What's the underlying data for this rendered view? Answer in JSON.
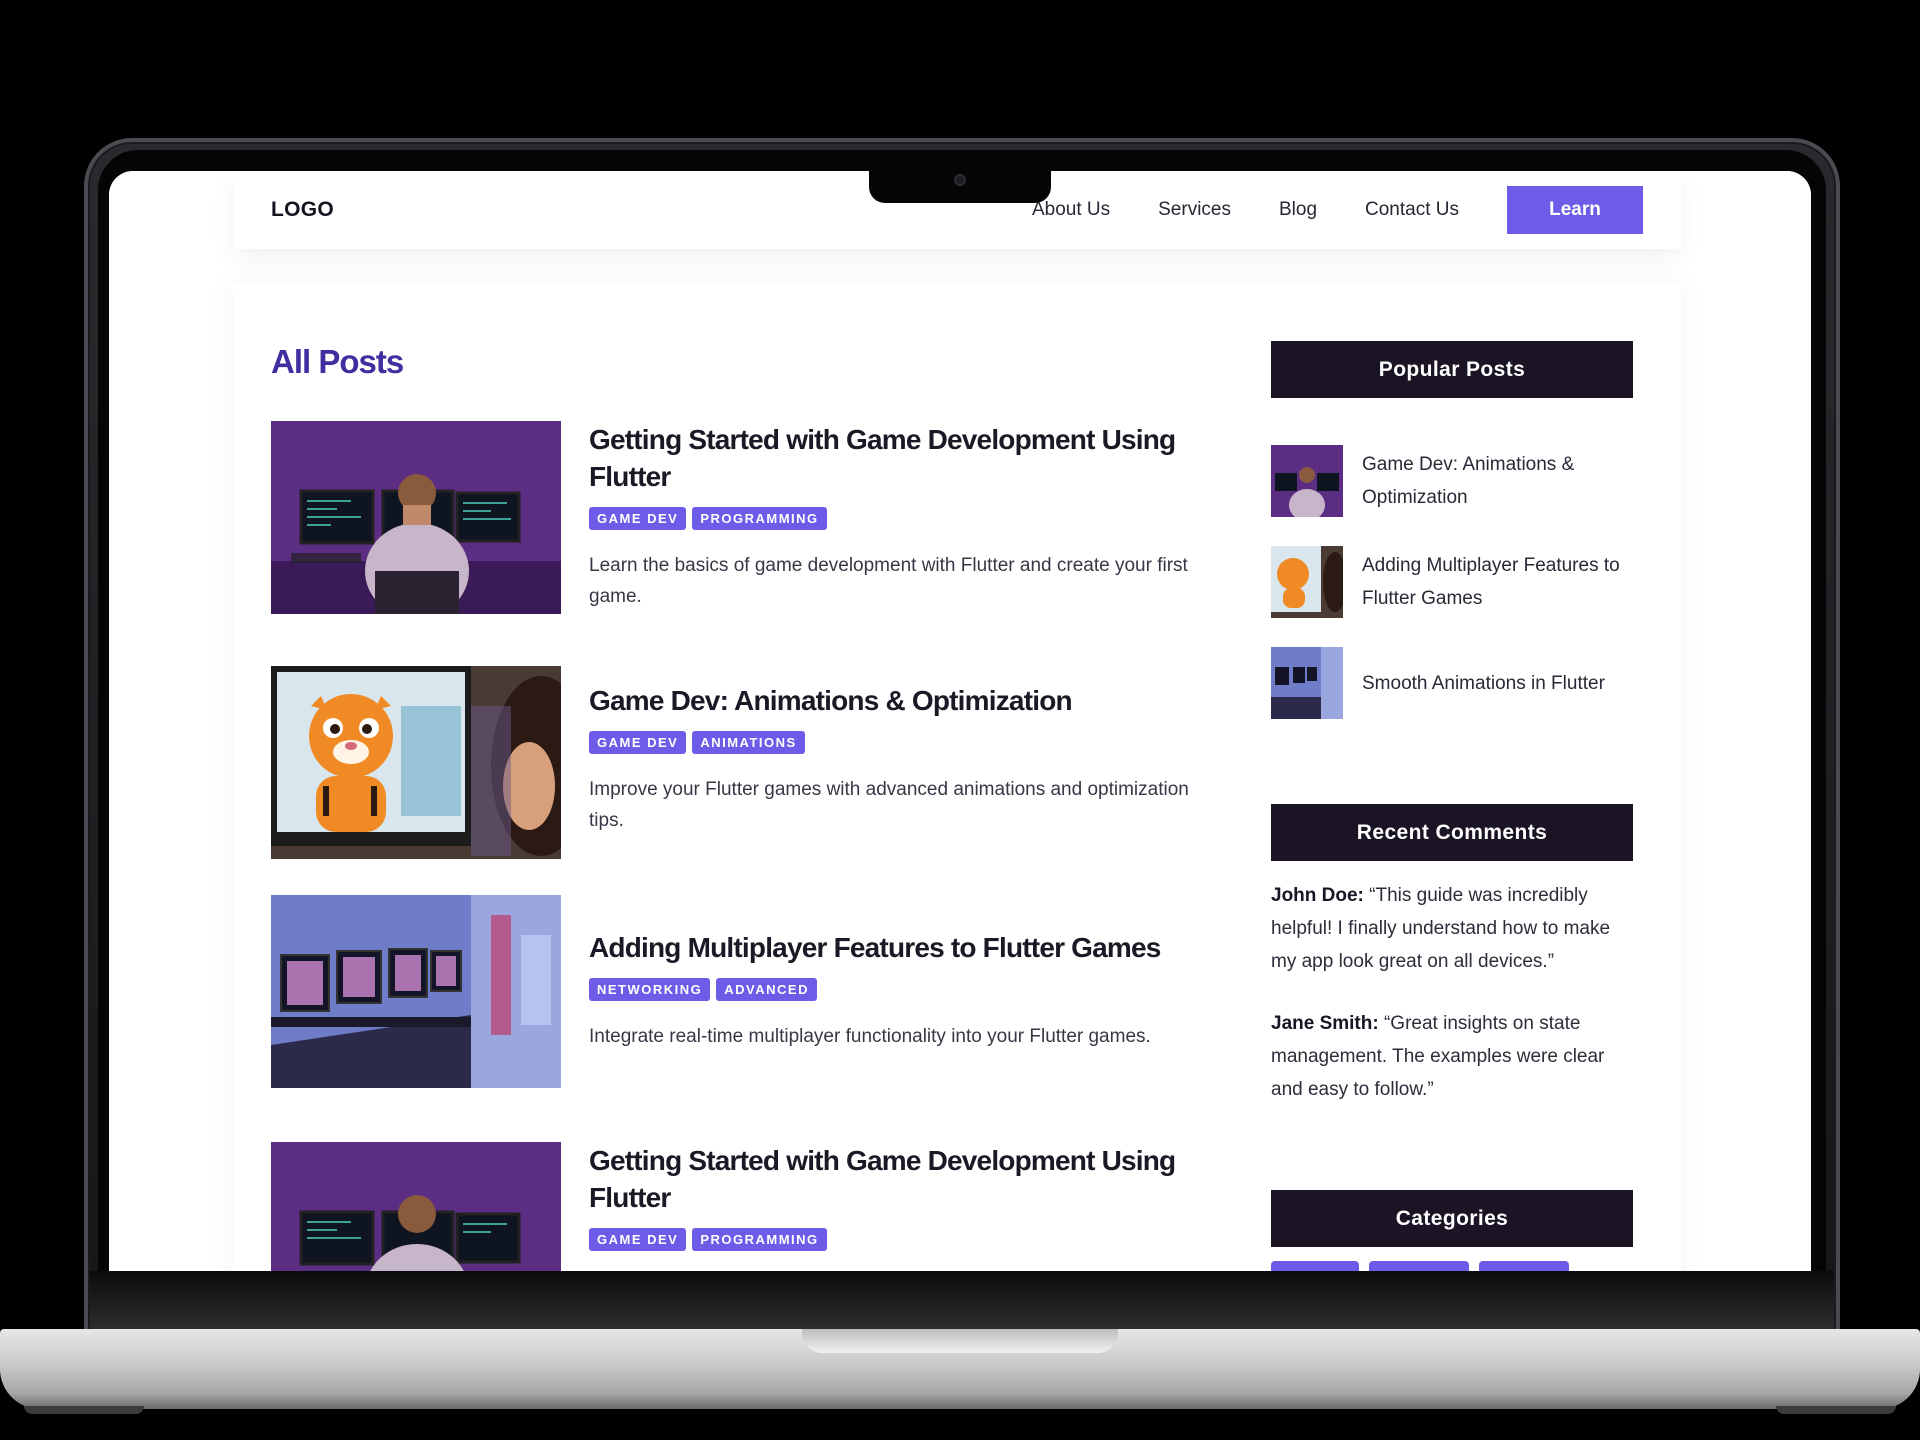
{
  "nav": {
    "logo": "LOGO",
    "links": [
      "About Us",
      "Services",
      "Blog",
      "Contact Us"
    ],
    "cta": "Learn"
  },
  "main": {
    "heading": "All Posts",
    "posts": [
      {
        "title": "Getting Started with Game Development Using Flutter",
        "tags": [
          "GAME DEV",
          "PROGRAMMING"
        ],
        "excerpt": "Learn the basics of game development with Flutter and create your first game."
      },
      {
        "title": "Game Dev: Animations & Optimization",
        "tags": [
          "GAME DEV",
          "ANIMATIONS"
        ],
        "excerpt": "Improve your Flutter games with advanced animations and optimization tips."
      },
      {
        "title": "Adding Multiplayer Features to Flutter Games",
        "tags": [
          "NETWORKING",
          "ADVANCED"
        ],
        "excerpt": "Integrate real-time multiplayer functionality into your Flutter games."
      },
      {
        "title": "Getting Started with Game Development Using Flutter",
        "tags": [
          "GAME DEV",
          "PROGRAMMING"
        ],
        "excerpt": ""
      }
    ]
  },
  "sidebar": {
    "popular": {
      "heading": "Popular Posts",
      "items": [
        "Game Dev: Animations & Optimization",
        "Adding Multiplayer Features to Flutter Games",
        "Smooth Animations in Flutter"
      ]
    },
    "comments": {
      "heading": "Recent Comments",
      "items": [
        {
          "author": "John Doe:",
          "text": "“This guide was incredibly helpful! I finally understand how to make my app look great on all devices.”"
        },
        {
          "author": "Jane Smith:",
          "text": "“Great insights on state management. The examples were clear and easy to follow.”"
        }
      ]
    },
    "categories": {
      "heading": "Categories"
    }
  },
  "theme": {
    "accent": "#6c5ce7",
    "heading_color": "#3f2fa0",
    "widget_bg": "#1a1424"
  }
}
